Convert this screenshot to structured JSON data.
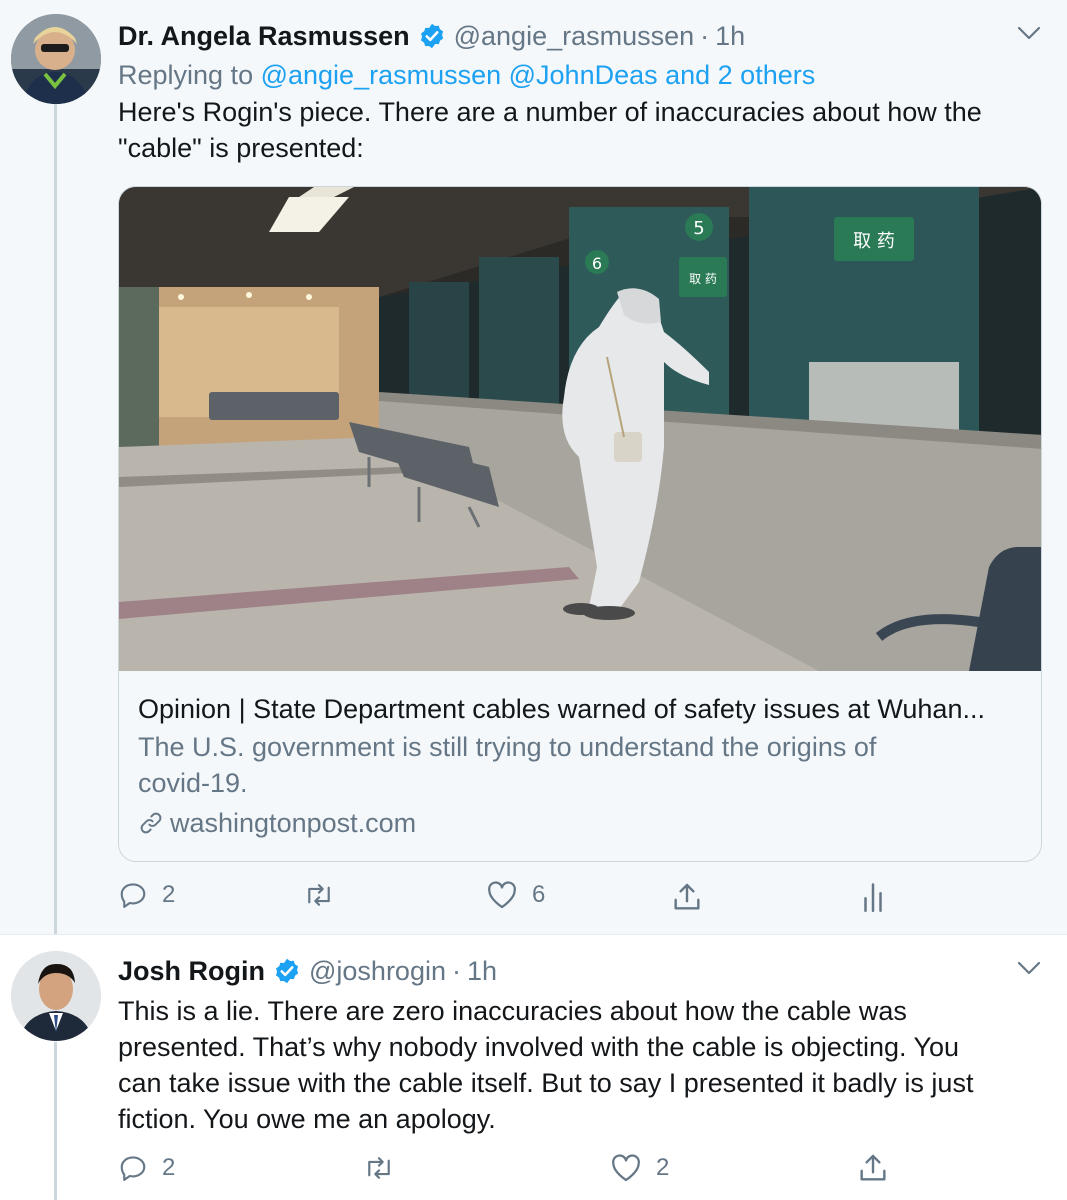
{
  "tweets": [
    {
      "author_name": "Dr. Angela Rasmussen",
      "handle": "@angie_rasmussen",
      "separator": "·",
      "time": "1h",
      "replying_prefix": "Replying to ",
      "replying_handles": "@angie_rasmussen @JohnDeas and 2 others",
      "text_line_1": "Here's Rogin's piece. There are a number of inaccuracies about how the",
      "text_line_2": "\"cable\" is presented:",
      "card": {
        "title": "Opinion | State Department cables warned of safety issues at Wuhan...",
        "description_line_1": "The U.S. government is still trying to understand the origins of",
        "description_line_2": "covid-19.",
        "domain": "washingtonpost.com",
        "image_signs": [
          "5",
          "6",
          "取 药",
          "取 药"
        ]
      },
      "replies_count": "2",
      "likes_count": "6"
    },
    {
      "author_name": "Josh Rogin",
      "handle": "@joshrogin",
      "separator": "·",
      "time": "1h",
      "text_lines": [
        "This is a lie. There are zero inaccuracies about how the cable was",
        "presented. That’s why nobody involved with the cable is objecting. You",
        "can take issue with the cable itself. But to say I presented it badly is just",
        "fiction. You owe me an apology."
      ],
      "replies_count": "2",
      "likes_count": "2"
    }
  ],
  "icons": {
    "verified": "verified-badge-icon",
    "menu": "chevron-down-icon",
    "reply": "reply-icon",
    "retweet": "retweet-icon",
    "like": "heart-icon",
    "share": "share-icon",
    "analytics": "analytics-icon",
    "link": "link-icon"
  },
  "colors": {
    "accent": "#1da1f2",
    "secondary_text": "#657786",
    "primary_text": "#14171a",
    "highlight_bg": "#f5f8fa"
  }
}
